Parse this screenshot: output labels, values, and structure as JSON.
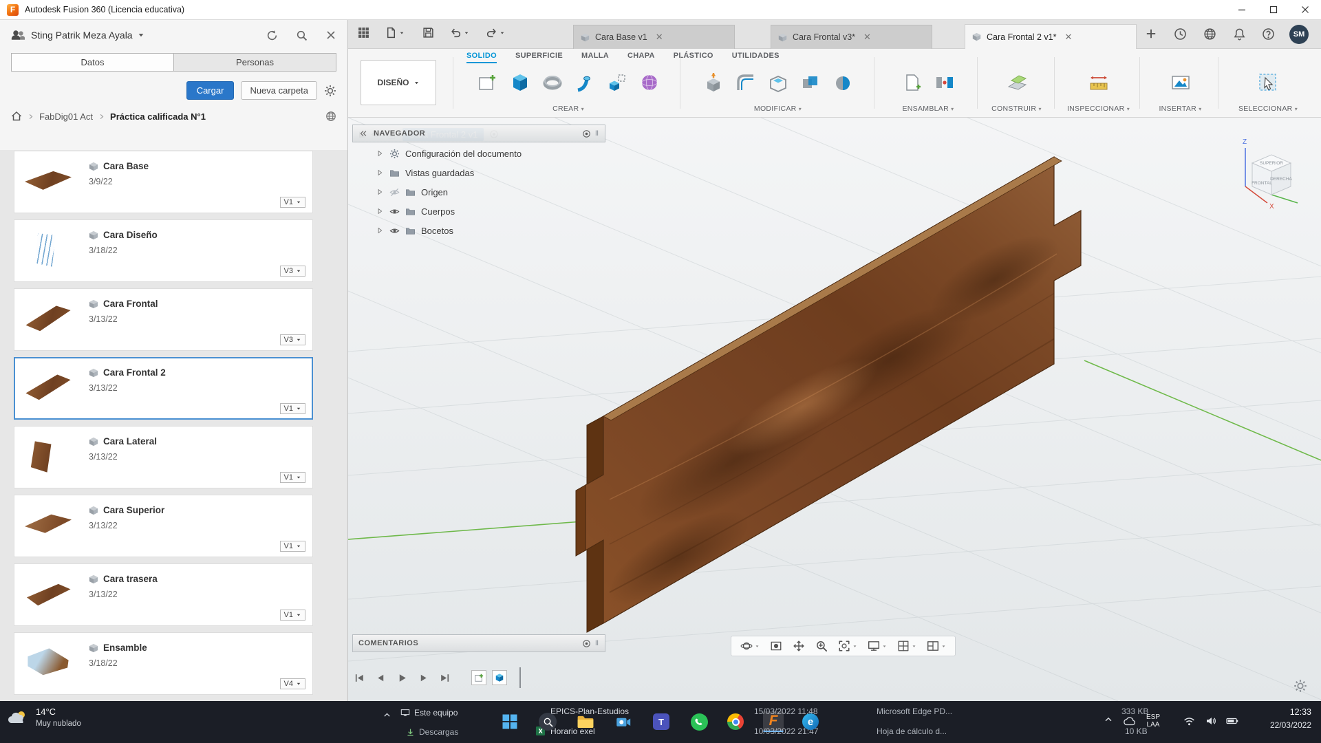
{
  "titlebar": {
    "title": "Autodesk Fusion 360 (Licencia educativa)"
  },
  "colors": {
    "accent": "#0696d7",
    "selection_blue": "#4a90d2",
    "wood_brown": "#7c4a26",
    "axis_green": "#63b53a",
    "taskbar_dark": "#1b1e26",
    "fusion_orange": "#f0831e"
  },
  "data_panel": {
    "user_name": "Sting Patrik Meza Ayala",
    "tab_datos": "Datos",
    "tab_personas": "Personas",
    "upload_button": "Cargar",
    "new_folder_button": "Nueva carpeta",
    "breadcrumb_root": "FabDig01 Act",
    "breadcrumb_current": "Práctica calificada N°1",
    "items": [
      {
        "name": "Cara Base",
        "date": "3/9/22",
        "version": "V1"
      },
      {
        "name": "Cara Diseño",
        "date": "3/18/22",
        "version": "V3"
      },
      {
        "name": "Cara Frontal",
        "date": "3/13/22",
        "version": "V3"
      },
      {
        "name": "Cara Frontal 2",
        "date": "3/13/22",
        "version": "V1"
      },
      {
        "name": "Cara Lateral",
        "date": "3/13/22",
        "version": "V1"
      },
      {
        "name": "Cara Superior",
        "date": "3/13/22",
        "version": "V1"
      },
      {
        "name": "Cara trasera",
        "date": "3/13/22",
        "version": "V1"
      },
      {
        "name": "Ensamble",
        "date": "3/18/22",
        "version": "V4"
      }
    ]
  },
  "document_tabs": {
    "tabs": [
      {
        "label": "Cara Base v1"
      },
      {
        "label": "Cara Frontal v3*"
      },
      {
        "label": "Cara Frontal 2 v1*"
      }
    ],
    "avatar": "SM"
  },
  "ribbon": {
    "workspace": "DISEÑO",
    "tabs": [
      "SOLIDO",
      "SUPERFICIE",
      "MALLA",
      "CHAPA",
      "PLÁSTICO",
      "UTILIDADES"
    ],
    "groups": [
      "CREAR",
      "MODIFICAR",
      "ENSAMBLAR",
      "CONSTRUIR",
      "INSPECCIONAR",
      "INSERTAR",
      "SELECCIONAR"
    ]
  },
  "navigator": {
    "title": "NAVEGADOR",
    "root": "Cara Frontal 2 v1",
    "nodes": [
      "Configuración del documento",
      "Vistas guardadas",
      "Origen",
      "Cuerpos",
      "Bocetos"
    ]
  },
  "viewport": {
    "comments_title": "COMENTARIOS",
    "viewcube": {
      "top": "SUPERIOR",
      "front": "FRONTAL",
      "right": "DERECHA",
      "axis_z": "Z",
      "axis_x": "X"
    }
  },
  "taskbar": {
    "weather_temp": "14°C",
    "weather_desc": "Muy nublado",
    "explorer": {
      "sidebar_top": "Este equipo",
      "sidebar_bottom": "Descargas",
      "files": [
        {
          "name": "EPICS-Plan-Estudios",
          "date": "15/03/2022 11:48",
          "type": "Microsoft Edge PD...",
          "size": "333 KB"
        },
        {
          "name": "Horario exel",
          "date": "10/03/2022 21:47",
          "type": "Hoja de cálculo d...",
          "size": "10 KB"
        }
      ]
    },
    "tray": {
      "lang_line1": "ESP",
      "lang_line2": "LAA",
      "time": "12:33",
      "date": "22/03/2022"
    }
  }
}
